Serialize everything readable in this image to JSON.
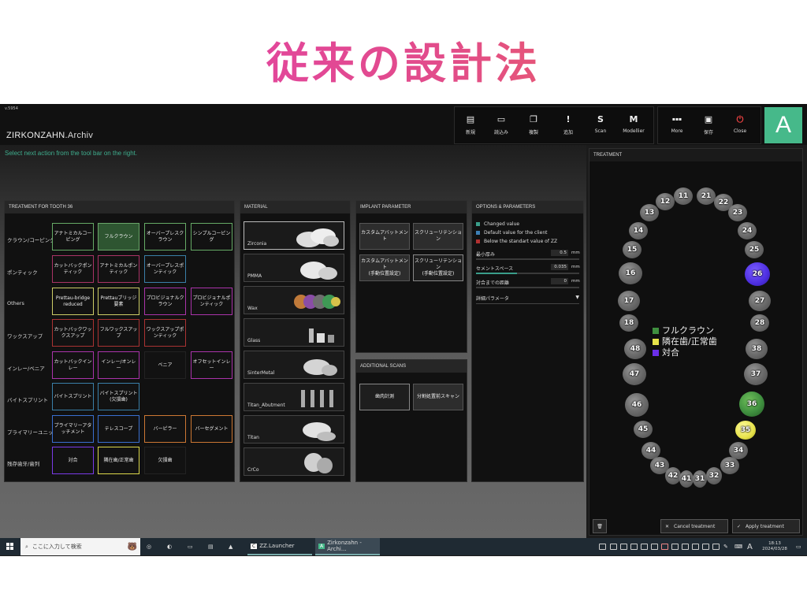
{
  "slide_title": "従来の設計法",
  "app": {
    "version": "v.5954",
    "brand_main": "ZIRKONZAHN",
    "brand_sub": ".Archiv",
    "hint": "Select next action from the tool bar on the right.",
    "toolbar_main": [
      {
        "label": "新規",
        "icon": "new-doc-icon",
        "glyph": "▤"
      },
      {
        "label": "読込み",
        "icon": "folder-icon",
        "glyph": "▭"
      },
      {
        "label": "複製",
        "icon": "duplicate-icon",
        "glyph": "❐"
      },
      {
        "label": "追加",
        "icon": "exclamation-icon",
        "glyph": "!"
      },
      {
        "label": "Scan",
        "icon": "scan-s-icon",
        "glyph": "S"
      },
      {
        "label": "Modellier",
        "icon": "modellier-m-icon",
        "glyph": "M"
      }
    ],
    "toolbar_right": [
      {
        "label": "More",
        "icon": "more-icon",
        "glyph": "▪▪▪"
      },
      {
        "label": "保存",
        "icon": "save-icon",
        "glyph": "▣"
      },
      {
        "label": "Close",
        "icon": "close-power-icon",
        "glyph": "⏻"
      }
    ],
    "logo_letter": "A",
    "accent": "#46b98a"
  },
  "treatment_panel": {
    "title": "TREATMENT FOR TOOTH 36",
    "rows": [
      {
        "label": "クラウン/コーピング",
        "buttons": [
          "アナトミカルコーピング",
          "フルクラウン",
          "オーバープレスクラウン",
          "シンプルコーピング"
        ]
      },
      {
        "label": "ポンティック",
        "buttons": [
          "カットバックポンティック",
          "アナトミカルポンティック",
          "オーバープレスポンティック"
        ]
      },
      {
        "label": "Others",
        "buttons": [
          "Prettau-bridge reduced",
          "Prettauブリッジ要素",
          "プロビジョナルクラウン",
          "プロビジョナルポンティック"
        ]
      },
      {
        "label": "ワックスアップ",
        "buttons": [
          "カットバックワックスアップ",
          "フルワックスアップ",
          "ワックスアップポンティック"
        ]
      },
      {
        "label": "インレー/ベニア",
        "buttons": [
          "カットバックインレー",
          "インレー/オンレー",
          "ベニア",
          "オフセットインレー"
        ]
      },
      {
        "label": "バイトスプリント",
        "buttons": [
          "バイトスプリント",
          "バイトスプリント(欠損歯)"
        ]
      },
      {
        "label": "プライマリーユニット",
        "buttons": [
          "プライマリーアタッチメント",
          "テレスコープ",
          "バーピラー",
          "バーセグメント"
        ]
      },
      {
        "label": "残存歯牙/歯列",
        "buttons": [
          "対合",
          "隣在歯/正常歯",
          "欠損歯"
        ]
      }
    ]
  },
  "material_panel": {
    "title": "MATERIAL",
    "items": [
      "Zirconia",
      "PMMA",
      "Wax",
      "Glass",
      "SinterMetal",
      "Titan_Abutment",
      "Titan",
      "CrCo"
    ]
  },
  "implant_panel": {
    "title": "IMPLANT PARAMETER",
    "buttons": [
      "カスタムアバットメント",
      "スクリューリテンション",
      "カスタムアバットメント\n(手動位置設定)",
      "スクリューリテンション\n(手動位置設定)"
    ]
  },
  "scans_panel": {
    "title": "ADDITIONAL SCANS",
    "buttons": [
      "歯肉計測",
      "分割処置前スキャン"
    ]
  },
  "options_panel": {
    "title": "OPTIONS & PARAMETERS",
    "legend": [
      {
        "label": "Changed value",
        "color": "#3a9e8a"
      },
      {
        "label": "Default value for the client",
        "color": "#3d7fb5"
      },
      {
        "label": "Below the standart value of ZZ",
        "color": "#b03030"
      }
    ],
    "params": [
      {
        "label": "最小厚み",
        "value": "0.5",
        "unit": "mm",
        "fill": 0.0
      },
      {
        "label": "セメントスペース",
        "value": "0.035",
        "unit": "mm",
        "fill": 0.4
      },
      {
        "label": "対合までの距離",
        "value": "0",
        "unit": "mm",
        "fill": 0.0
      }
    ],
    "detail_dropdown": "詳細パラメータ"
  },
  "treatment_chart": {
    "title": "TREATMENT",
    "legend": [
      {
        "label": "フルクラウン",
        "color": "#3f8f3f"
      },
      {
        "label": "隣在歯/正常歯",
        "color": "#e6e24a"
      },
      {
        "label": "対合",
        "color": "#6a2ee8"
      }
    ],
    "teeth_status": {
      "36": "フルクラウン",
      "35": "隣在歯/正常歯",
      "26": "対合"
    },
    "cancel_label": "Cancel treatment",
    "apply_label": "Apply treatment"
  },
  "taskbar": {
    "search_placeholder": "ここに入力して検索",
    "apps": [
      "ZZ.Launcher",
      "Zirkonzahn - Archi..."
    ],
    "ime": "A",
    "time": "18:13",
    "date": "2024/03/28"
  }
}
